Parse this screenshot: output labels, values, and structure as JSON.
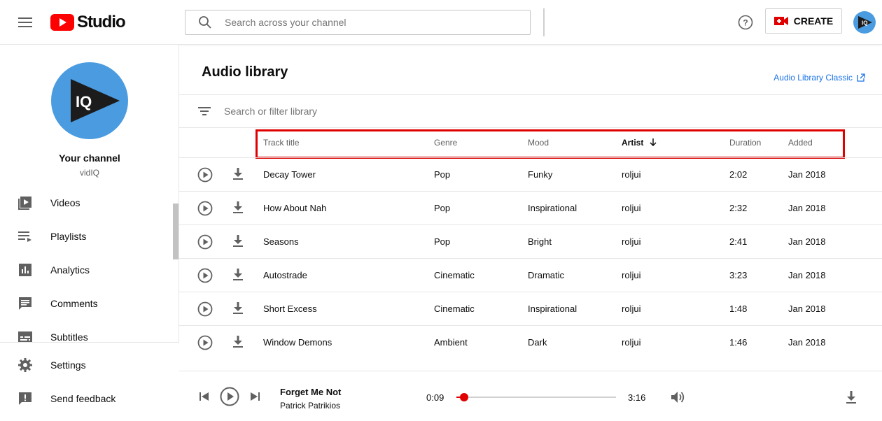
{
  "header": {
    "logo_text": "Studio",
    "search_placeholder": "Search across your channel",
    "create_label": "CREATE",
    "avatar_text": "IQ"
  },
  "sidebar": {
    "avatar_text": "IQ",
    "channel_label": "Your channel",
    "channel_name": "vidIQ",
    "items": [
      {
        "label": "Videos",
        "icon": "videos-icon"
      },
      {
        "label": "Playlists",
        "icon": "playlists-icon"
      },
      {
        "label": "Analytics",
        "icon": "analytics-icon"
      },
      {
        "label": "Comments",
        "icon": "comments-icon"
      },
      {
        "label": "Subtitles",
        "icon": "subtitles-icon"
      }
    ],
    "bottom_items": [
      {
        "label": "Settings",
        "icon": "settings-icon"
      },
      {
        "label": "Send feedback",
        "icon": "feedback-icon"
      }
    ]
  },
  "main": {
    "title": "Audio library",
    "classic_link": "Audio Library Classic",
    "filter_placeholder": "Search or filter library",
    "columns": {
      "title": "Track title",
      "genre": "Genre",
      "mood": "Mood",
      "artist": "Artist",
      "duration": "Duration",
      "added": "Added"
    },
    "tracks": [
      {
        "title": "Decay Tower",
        "genre": "Pop",
        "mood": "Funky",
        "artist": "roljui",
        "duration": "2:02",
        "added": "Jan 2018"
      },
      {
        "title": "How About Nah",
        "genre": "Pop",
        "mood": "Inspirational",
        "artist": "roljui",
        "duration": "2:32",
        "added": "Jan 2018"
      },
      {
        "title": "Seasons",
        "genre": "Pop",
        "mood": "Bright",
        "artist": "roljui",
        "duration": "2:41",
        "added": "Jan 2018"
      },
      {
        "title": "Autostrade",
        "genre": "Cinematic",
        "mood": "Dramatic",
        "artist": "roljui",
        "duration": "3:23",
        "added": "Jan 2018"
      },
      {
        "title": "Short Excess",
        "genre": "Cinematic",
        "mood": "Inspirational",
        "artist": "roljui",
        "duration": "1:48",
        "added": "Jan 2018"
      },
      {
        "title": "Window Demons",
        "genre": "Ambient",
        "mood": "Dark",
        "artist": "roljui",
        "duration": "1:46",
        "added": "Jan 2018"
      }
    ]
  },
  "player": {
    "title": "Forget Me Not",
    "artist": "Patrick Patrikios",
    "current_time": "0:09",
    "total_time": "3:16",
    "progress": 0.05
  },
  "colors": {
    "accent_red": "#e00000",
    "link_blue": "#1a73e8",
    "avatar_blue": "#4a9be0"
  }
}
